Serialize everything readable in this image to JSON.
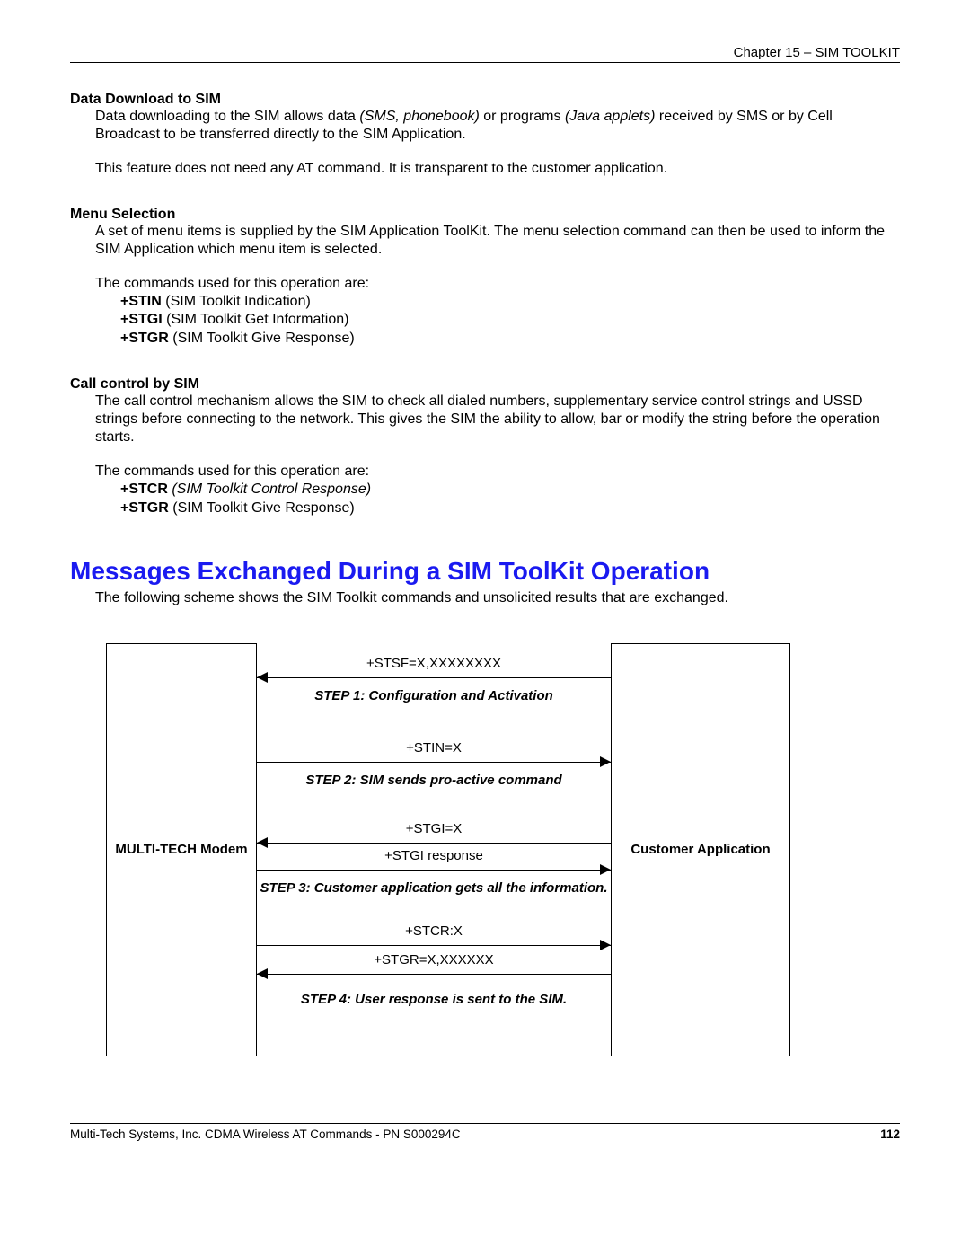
{
  "chapter": "Chapter 15 – SIM TOOLKIT",
  "s1": {
    "title": "Data Download to SIM",
    "p1a": "Data downloading to the SIM allows data ",
    "p1b": "(SMS, phonebook)",
    "p1c": " or programs ",
    "p1d": "(Java applets)",
    "p1e": " received by SMS or by Cell Broadcast to be transferred directly to the SIM Application.",
    "p2": "This feature does not need any AT command. It is transparent to the customer application."
  },
  "s2": {
    "title": "Menu Selection",
    "p1": "A set of menu items is supplied by the SIM Application ToolKit. The menu selection command can then be used to inform the SIM Application which menu item is selected.",
    "p2": "The commands used for this operation are:",
    "c1b": "+STIN",
    "c1t": " (SIM Toolkit Indication)",
    "c2b": "+STGI",
    "c2t": " (SIM Toolkit Get Information)",
    "c3b": "+STGR",
    "c3t": " (SIM Toolkit Give Response)"
  },
  "s3": {
    "title": "Call control by SIM",
    "p1": "The call control mechanism allows the SIM to check all dialed numbers, supplementary service control strings and USSD strings before connecting to the network. This gives the SIM the ability to allow, bar or modify the string before the operation starts.",
    "p2": "The commands used for this operation are:",
    "c1b": "+STCR",
    "c1t": " (SIM Toolkit Control Response)",
    "c2b": "+STGR",
    "c2t": " (SIM Toolkit Give Response)"
  },
  "h2": "Messages Exchanged During a SIM ToolKit Operation",
  "h2sub": "The following scheme shows the SIM Toolkit commands and unsolicited results that are exchanged.",
  "diagram": {
    "left": "MULTI-TECH Modem",
    "right": "Customer Application",
    "r1": "+STSF=X,XXXXXXXX",
    "st1": "STEP 1: Configuration and Activation",
    "r2": "+STIN=X",
    "st2": "STEP 2: SIM sends pro-active command",
    "r3a": "+STGI=X",
    "r3b": "+STGI response",
    "st3": "STEP 3: Customer application gets all the information.",
    "r4a": "+STCR:X",
    "r4b": "+STGR=X,XXXXXX",
    "st4": "STEP 4: User response is sent to the SIM."
  },
  "footer": {
    "left": "Multi-Tech Systems, Inc. CDMA Wireless AT Commands - PN S000294C",
    "page": "112"
  }
}
